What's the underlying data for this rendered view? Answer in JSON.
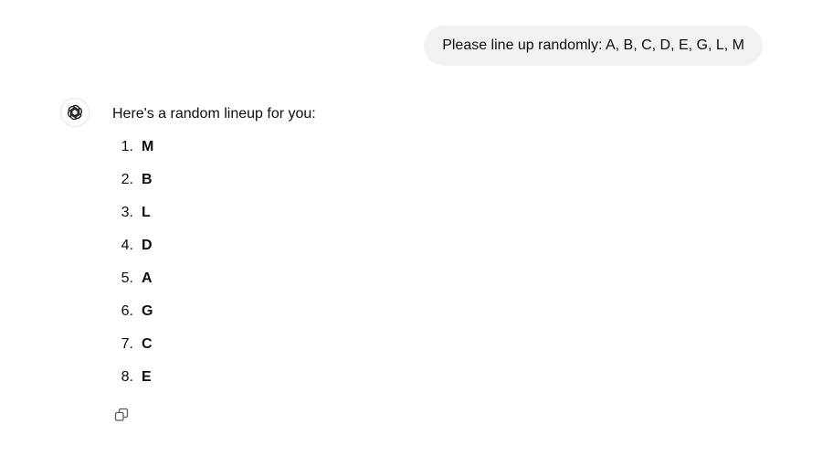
{
  "user_message": {
    "text": "Please line up randomly: A, B, C, D, E, G, L, M"
  },
  "assistant": {
    "avatar_icon": "openai-logo-icon",
    "intro": "Here's a random lineup for you:",
    "lineup": [
      {
        "number": "1.",
        "letter": "M"
      },
      {
        "number": "2.",
        "letter": "B"
      },
      {
        "number": "3.",
        "letter": "L"
      },
      {
        "number": "4.",
        "letter": "D"
      },
      {
        "number": "5.",
        "letter": "A"
      },
      {
        "number": "6.",
        "letter": "G"
      },
      {
        "number": "7.",
        "letter": "C"
      },
      {
        "number": "8.",
        "letter": "E"
      }
    ],
    "actions": {
      "copy_icon": "copy-icon"
    }
  },
  "colors": {
    "user_bubble_bg": "#f2f2f2",
    "text": "#0d0d0d",
    "icon": "#5d5d5d"
  }
}
